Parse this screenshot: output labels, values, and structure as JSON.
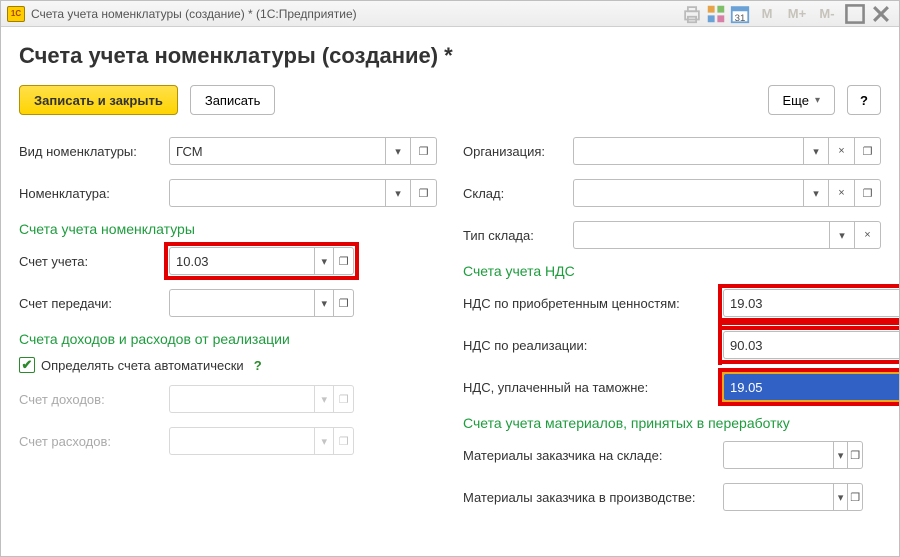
{
  "window": {
    "title": "Счета учета номенклатуры (создание) *   (1С:Предприятие)"
  },
  "header": {
    "form_title": "Счета учета номенклатуры (создание) *"
  },
  "cmdbar": {
    "save_close": "Записать и закрыть",
    "save": "Записать",
    "more": "Еще",
    "help": "?"
  },
  "left": {
    "nomenclature_type_label": "Вид номенклатуры:",
    "nomenclature_type_value": "ГСМ",
    "nomenclature_label": "Номенклатура:",
    "nomenclature_value": "",
    "group1_title": "Счета учета номенклатуры",
    "account_label": "Счет учета:",
    "account_value": "10.03",
    "transfer_account_label": "Счет передачи:",
    "transfer_account_value": "",
    "group2_title": "Счета доходов и расходов от реализации",
    "auto_checkbox_label": "Определять счета автоматически",
    "income_label": "Счет доходов:",
    "income_value": "",
    "expense_label": "Счет расходов:",
    "expense_value": ""
  },
  "right": {
    "org_label": "Организация:",
    "warehouse_label": "Склад:",
    "warehouse_type_label": "Тип склада:",
    "group1_title": "Счета учета НДС",
    "vat_purchase_label": "НДС по приобретенным ценностям:",
    "vat_purchase_value": "19.03",
    "vat_sale_label": "НДС по реализации:",
    "vat_sale_value": "90.03",
    "vat_customs_label": "НДС, уплаченный на таможне:",
    "vat_customs_value": "19.05",
    "group2_title": "Счета учета материалов, принятых в переработку",
    "mat_store_label": "Материалы заказчика на складе:",
    "mat_prod_label": "Материалы заказчика в производстве:"
  },
  "icons": {
    "dropdown": "▾",
    "clear": "×",
    "open": "❐"
  },
  "title_icons": {
    "m": "M",
    "mplus": "M+",
    "mminus": "M-"
  }
}
